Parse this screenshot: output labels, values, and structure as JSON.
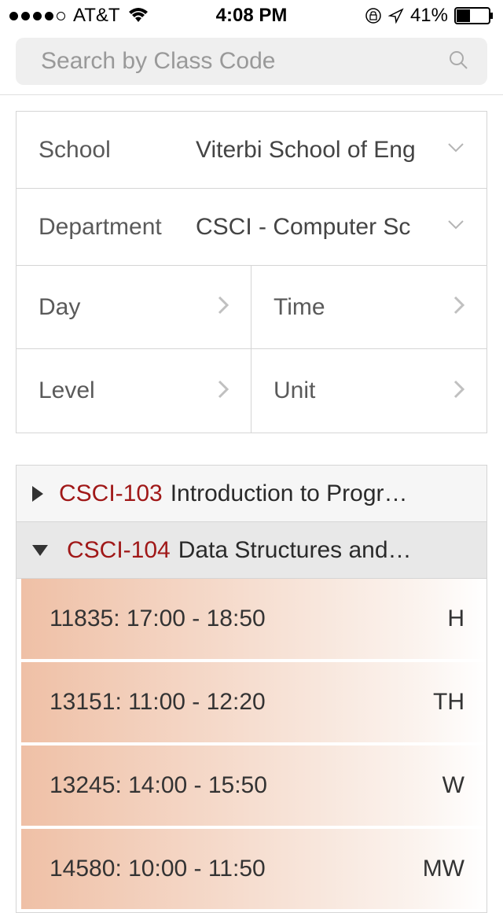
{
  "status": {
    "carrier": "AT&T",
    "time": "4:08 PM",
    "battery": "41%"
  },
  "search": {
    "placeholder": "Search by Class Code"
  },
  "filters": {
    "school": {
      "label": "School",
      "value": "Viterbi School of Eng"
    },
    "department": {
      "label": "Department",
      "value": "CSCI - Computer Sc"
    },
    "day": {
      "label": "Day"
    },
    "time": {
      "label": "Time"
    },
    "level": {
      "label": "Level"
    },
    "unit": {
      "label": "Unit"
    }
  },
  "courses": [
    {
      "code": "CSCI-103",
      "title": "Introduction to Progr…",
      "expanded": false
    },
    {
      "code": "CSCI-104",
      "title": "Data Structures and…",
      "expanded": true
    }
  ],
  "sections": [
    {
      "id": "11835",
      "time": "17:00 - 18:50",
      "day": "H"
    },
    {
      "id": "13151",
      "time": "11:00 - 12:20",
      "day": "TH"
    },
    {
      "id": "13245",
      "time": "14:00 - 15:50",
      "day": "W"
    },
    {
      "id": "14580",
      "time": "10:00 - 11:50",
      "day": "MW"
    }
  ]
}
